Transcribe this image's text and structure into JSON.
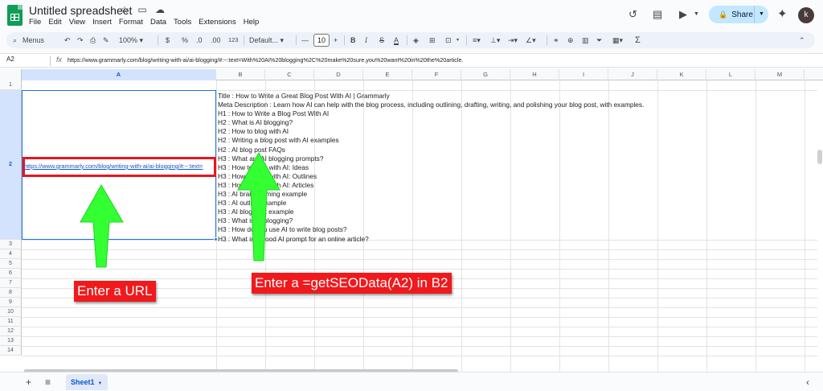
{
  "header": {
    "title": "Untitled spreadsheet",
    "menu": [
      "File",
      "Edit",
      "View",
      "Insert",
      "Format",
      "Data",
      "Tools",
      "Extensions",
      "Help"
    ],
    "share_label": "Share",
    "avatar_initial": "k"
  },
  "toolbar": {
    "menus_label": "Menus",
    "zoom": "100%",
    "currency": "$",
    "percent": "%",
    "dec_decrease": ".0",
    "dec_increase": ".00",
    "number_format": "123",
    "font_name": "Default...",
    "font_size": "10",
    "bold": "B",
    "italic": "I",
    "strike": "S",
    "text_color": "A",
    "sum": "Σ"
  },
  "formula_bar": {
    "name_box": "A2",
    "fx": "fx",
    "value": "https://www.grammarly.com/blog/writing-with-ai/ai-blogging/#:~:text=With%20AI%20blogging%2C%20make%20sure,you%20want%20in%20the%20article."
  },
  "columns": [
    "A",
    "B",
    "C",
    "D",
    "E",
    "F",
    "G",
    "H",
    "I",
    "J",
    "K",
    "L",
    "M"
  ],
  "rows": [
    "1",
    "2",
    "3",
    "4",
    "5",
    "6",
    "7",
    "8",
    "9",
    "10",
    "11",
    "12",
    "13",
    "14"
  ],
  "cells": {
    "a2": "https://www.grammarly.com/blog/writing-with-ai/ai-blogging/#:~:text=",
    "b2_lines": [
      "Title : How to Write a Great Blog Post With AI | Grammarly",
      "Meta Description : Learn how AI can help with the blog process, including outlining, drafting, writing, and polishing your blog post, with examples.",
      "H1 : How to Write a Blog Post With AI",
      "H2 : What is AI blogging?",
      "H2 : How to blog with AI",
      "H2 : Writing a blog post with AI examples",
      "H2 : AI blog post FAQs",
      "H3 : What are AI blogging prompts?",
      "H3 : How to blog with AI: Ideas",
      "H3 : How to blog with AI: Outlines",
      "H3 : How to blog with AI: Articles",
      "H3 : AI brainstorming example",
      "H3 : AI outline example",
      "H3 : AI blog post example",
      "H3 : What is AI blogging?",
      "H3 : How do you use AI to write blog posts?",
      "H3 : What is a good AI prompt for an online article?"
    ]
  },
  "annotations": {
    "enter_url": "Enter a URL",
    "enter_formula": "Enter a  =getSEOData(A2) in B2",
    "arrow_color": "#33ff33",
    "box_color": "#e8161f"
  },
  "sheets": {
    "active": "Sheet1"
  }
}
